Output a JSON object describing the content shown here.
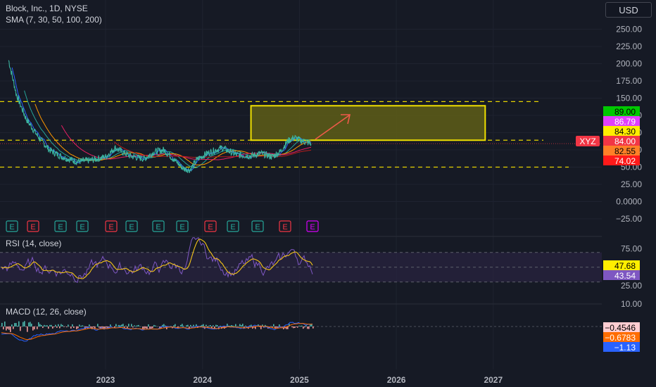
{
  "header": {
    "title": "Block, Inc., 1D, NYSE",
    "sma_label": "SMA (7, 30, 50, 100, 200)",
    "currency": "USD"
  },
  "colors": {
    "background": "#161a25",
    "zone_fill": "#5a5a18",
    "zone_border": "#f0e000",
    "dashed_level": "#e6d200",
    "price_line": "#3bb4a0",
    "projection_arrow": "#f05a4a",
    "rsi_line": "#7e57c2",
    "rsi_signal": "#f5c518",
    "rsi_band": "#2a2440",
    "macd_line": "#2962ff",
    "macd_signal": "#ff6d00"
  },
  "main_panel": {
    "y_ticks": [
      "250.00",
      "225.00",
      "200.00",
      "175.00",
      "150.00",
      "125.00",
      "100.00",
      "75.00",
      "50.00",
      "25.00",
      "0.0000",
      "−25.00"
    ],
    "x_ticks": [
      "2023",
      "2024",
      "2025",
      "2026",
      "2027"
    ],
    "symbol_badge": "XYZ",
    "price_labels": [
      {
        "text": "89.00",
        "bg": "#00c800",
        "fg": "#000000"
      },
      {
        "text": "86.79",
        "bg": "#e040fb",
        "fg": "#ffffff"
      },
      {
        "text": "84.30",
        "bg": "#ffee00",
        "fg": "#000000"
      },
      {
        "text": "84.00",
        "bg": "#f23645",
        "fg": "#ffffff"
      },
      {
        "text": "82.55",
        "bg": "#ff7f27",
        "fg": "#000000"
      },
      {
        "text": "74.02",
        "bg": "#ff1a1a",
        "fg": "#ffffff"
      }
    ],
    "key_levels": [
      145,
      89,
      50
    ],
    "target_zone": {
      "from_date": "2024-07",
      "to_date": "2026-12",
      "low": 89,
      "high": 139
    },
    "sma_lines": [
      {
        "period": 7,
        "color": "#2962ff"
      },
      {
        "period": 30,
        "color": "#26a69a"
      },
      {
        "period": 50,
        "color": "#ff9800"
      },
      {
        "period": 100,
        "color": "#e91e63"
      },
      {
        "period": 200,
        "color": "#b71c1c"
      }
    ],
    "earnings_markers": [
      {
        "label": "E",
        "kind": "beat"
      },
      {
        "label": "E",
        "kind": "miss"
      },
      {
        "label": "E",
        "kind": "beat"
      },
      {
        "label": "E",
        "kind": "beat"
      },
      {
        "label": "E",
        "kind": "miss"
      },
      {
        "label": "E",
        "kind": "beat"
      },
      {
        "label": "E",
        "kind": "beat"
      },
      {
        "label": "E",
        "kind": "beat"
      },
      {
        "label": "E",
        "kind": "miss"
      },
      {
        "label": "E",
        "kind": "beat"
      },
      {
        "label": "E",
        "kind": "beat"
      },
      {
        "label": "E",
        "kind": "miss"
      },
      {
        "label": "E",
        "kind": "upcoming"
      }
    ]
  },
  "rsi_panel": {
    "title": "RSI (14, close)",
    "y_ticks": [
      "75.00",
      "25.00"
    ],
    "labels": [
      {
        "text": "47.68",
        "bg": "#ffee00",
        "fg": "#000000"
      },
      {
        "text": "43.54",
        "bg": "#7e57c2",
        "fg": "#ffffff"
      }
    ],
    "upper_band": 70,
    "lower_band": 30
  },
  "macd_panel": {
    "title": "MACD (12, 26, close)",
    "y_ticks": [
      "10.00"
    ],
    "labels": [
      {
        "text": "−0.4546",
        "bg": "#ffcdd2",
        "fg": "#000000"
      },
      {
        "text": "−0.6783",
        "bg": "#ff6d00",
        "fg": "#ffffff"
      },
      {
        "text": "−1.13",
        "bg": "#2962ff",
        "fg": "#ffffff"
      }
    ]
  }
}
